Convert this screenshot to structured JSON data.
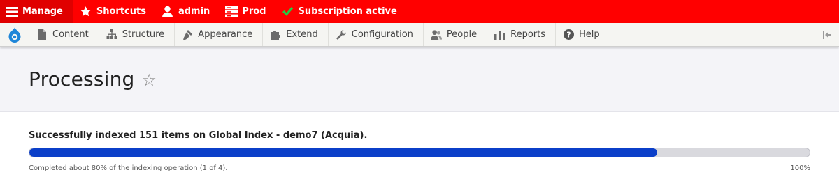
{
  "topbar": {
    "manage_label": "Manage",
    "shortcuts_label": "Shortcuts",
    "user_label": "admin",
    "env_label": "Prod",
    "subscription_label": "Subscription active",
    "accent_color": "#ff0000",
    "check_color": "#22cc44"
  },
  "toolbar": {
    "tabs": [
      {
        "label": "Content",
        "icon": "file-icon"
      },
      {
        "label": "Structure",
        "icon": "sitemap-icon"
      },
      {
        "label": "Appearance",
        "icon": "paintbrush-icon"
      },
      {
        "label": "Extend",
        "icon": "puzzle-icon"
      },
      {
        "label": "Configuration",
        "icon": "wrench-icon"
      },
      {
        "label": "People",
        "icon": "people-icon"
      },
      {
        "label": "Reports",
        "icon": "bar-chart-icon"
      },
      {
        "label": "Help",
        "icon": "help-icon"
      }
    ]
  },
  "page": {
    "title": "Processing"
  },
  "progress": {
    "message": "Successfully indexed 151 items on Global Index - demo7 (Acquia).",
    "status": "Completed about 80% of the indexing operation (1 of 4).",
    "percent_label": "100%",
    "fill_fraction": 0.805,
    "bar_color": "#0b3fc9"
  }
}
